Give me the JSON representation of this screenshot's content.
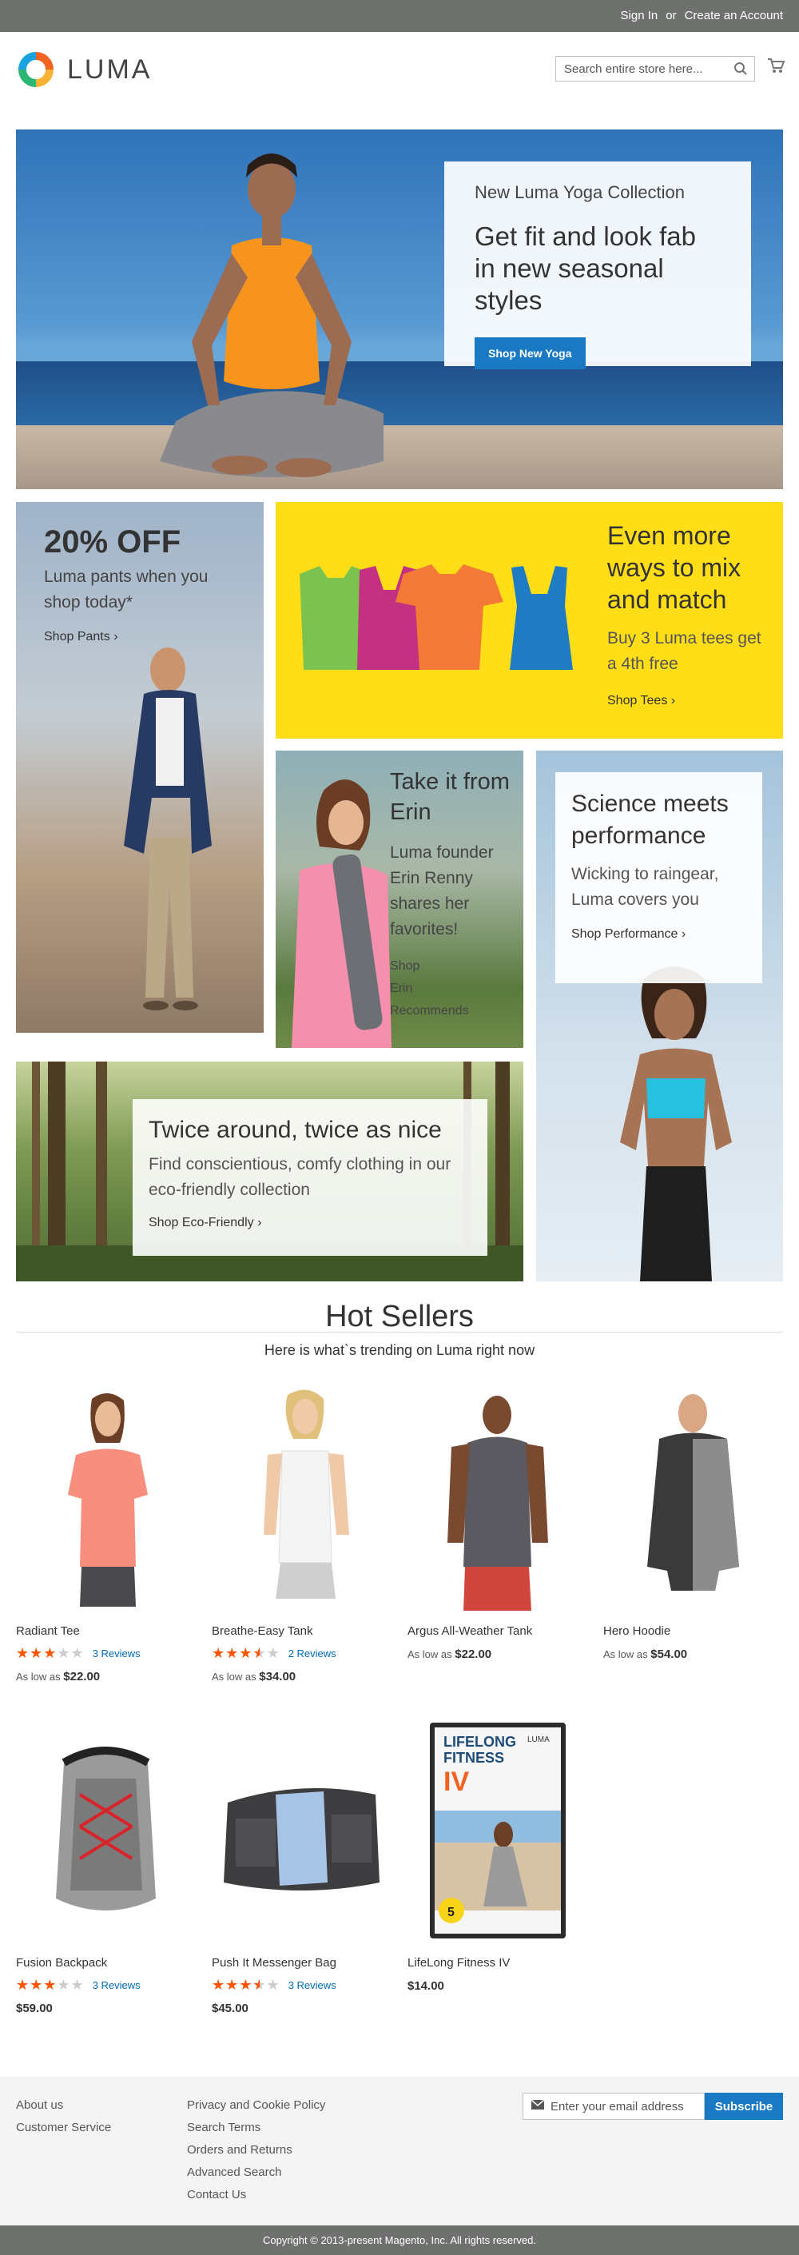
{
  "topbar": {
    "sign_in": "Sign In",
    "or": "or",
    "create_account": "Create an Account"
  },
  "header": {
    "logo_text": "LUMA",
    "search_placeholder": "Search entire store here..."
  },
  "hero": {
    "kicker": "New Luma Yoga Collection",
    "headline": "Get fit and look fab in new seasonal styles",
    "button": "Shop New Yoga"
  },
  "promos": {
    "pants": {
      "big": "20% OFF",
      "sub": "Luma pants when you shop today*",
      "link": "Shop Pants"
    },
    "tees": {
      "title": "Even more ways to mix and match",
      "sub": "Buy 3 Luma tees get a 4th free",
      "link": "Shop Tees"
    },
    "erin": {
      "title": "Take it from Erin",
      "sub": "Luma founder Erin Renny shares her favorites!",
      "link": "Shop Erin Recommends"
    },
    "performance": {
      "title": "Science meets performance",
      "sub": "Wicking to raingear, Luma covers you",
      "link": "Shop Performance"
    },
    "eco": {
      "title": "Twice around, twice as nice",
      "sub": "Find conscientious, comfy clothing in our eco-friendly collection",
      "link": "Shop Eco-Friendly"
    }
  },
  "hot_sellers": {
    "title": "Hot Sellers",
    "subtitle": "Here is what`s trending on Luma right now",
    "products": [
      {
        "name": "Radiant Tee",
        "rating": 0.6,
        "reviews": "3  Reviews",
        "price_prefix": "As low as",
        "price": "$22.00",
        "shirt_color": "#f88f7e"
      },
      {
        "name": "Breathe-Easy Tank",
        "rating": 0.7,
        "reviews": "2  Reviews",
        "price_prefix": "As low as",
        "price": "$34.00",
        "shirt_color": "#f4f4f4"
      },
      {
        "name": "Argus All-Weather Tank",
        "rating": null,
        "reviews": "",
        "price_prefix": "As low as",
        "price": "$22.00",
        "shirt_color": "#5a5a60"
      },
      {
        "name": "Hero Hoodie",
        "rating": null,
        "reviews": "",
        "price_prefix": "As low as",
        "price": "$54.00",
        "shirt_color": "#3a3a3a"
      },
      {
        "name": "Fusion Backpack",
        "rating": 0.6,
        "reviews": "3  Reviews",
        "price_prefix": "",
        "price": "$59.00"
      },
      {
        "name": "Push It Messenger Bag",
        "rating": 0.7,
        "reviews": "3  Reviews",
        "price_prefix": "",
        "price": "$45.00"
      },
      {
        "name": "LifeLong Fitness IV",
        "rating": null,
        "reviews": "",
        "price_prefix": "",
        "price": "$14.00"
      }
    ]
  },
  "dvd": {
    "line1": "LIFELONG",
    "line2": "FITNESS",
    "line3": "IV",
    "brand": "LUMA",
    "badge": "5"
  },
  "footer": {
    "col1": [
      "About us",
      "Customer Service"
    ],
    "col2": [
      "Privacy and Cookie Policy",
      "Search Terms",
      "Orders and Returns",
      "Advanced Search",
      "Contact Us"
    ],
    "newsletter_placeholder": "Enter your email address",
    "subscribe": "Subscribe",
    "copyright": "Copyright © 2013-present Magento, Inc. All rights reserved."
  }
}
